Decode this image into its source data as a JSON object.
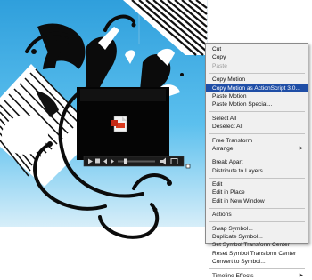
{
  "menu": {
    "items": [
      {
        "id": "cut",
        "label": "Cut",
        "disabled": false
      },
      {
        "id": "copy",
        "label": "Copy",
        "disabled": false
      },
      {
        "id": "paste",
        "label": "Paste",
        "disabled": true
      },
      {
        "sep": true
      },
      {
        "id": "copy-motion",
        "label": "Copy Motion",
        "disabled": false
      },
      {
        "id": "copy-motion-as3",
        "label": "Copy Motion as ActionScript 3.0...",
        "disabled": false,
        "selected": true
      },
      {
        "id": "paste-motion",
        "label": "Paste Motion",
        "disabled": false
      },
      {
        "id": "paste-motion-special",
        "label": "Paste Motion Special...",
        "disabled": false
      },
      {
        "sep": true
      },
      {
        "id": "select-all",
        "label": "Select All",
        "disabled": false
      },
      {
        "id": "deselect-all",
        "label": "Deselect All",
        "disabled": false
      },
      {
        "sep": true
      },
      {
        "id": "free-transform",
        "label": "Free Transform",
        "disabled": false
      },
      {
        "id": "arrange",
        "label": "Arrange",
        "disabled": false,
        "submenu": true
      },
      {
        "sep": true
      },
      {
        "id": "break-apart",
        "label": "Break Apart",
        "disabled": false
      },
      {
        "id": "distribute-to-layers",
        "label": "Distribute to Layers",
        "disabled": false
      },
      {
        "sep": true
      },
      {
        "id": "edit",
        "label": "Edit",
        "disabled": false
      },
      {
        "id": "edit-in-place",
        "label": "Edit in Place",
        "disabled": false
      },
      {
        "id": "edit-in-new-window",
        "label": "Edit in New Window",
        "disabled": false
      },
      {
        "sep": true
      },
      {
        "id": "actions",
        "label": "Actions",
        "disabled": false
      },
      {
        "sep": true
      },
      {
        "id": "swap-symbol",
        "label": "Swap Symbol...",
        "disabled": false
      },
      {
        "id": "duplicate-symbol",
        "label": "Duplicate Symbol...",
        "disabled": false
      },
      {
        "id": "set-symbol-transform-center",
        "label": "Set Symbol Transform Center",
        "disabled": false
      },
      {
        "id": "reset-symbol-transform-center",
        "label": "Reset Symbol Transform Center",
        "disabled": false
      },
      {
        "id": "convert-to-symbol",
        "label": "Convert to Symbol...",
        "disabled": false
      },
      {
        "sep": true
      },
      {
        "id": "timeline-effects",
        "label": "Timeline Effects",
        "disabled": false,
        "submenu": true
      }
    ],
    "submenu_arrow": "▶"
  },
  "stage": {
    "sky_color": "#3aaee3",
    "silhouette_color": "#0b0b0b",
    "stripe_color": "#111111",
    "video_icon": "video-file-icon",
    "player_controls": [
      "play-icon",
      "stop-icon",
      "back-icon",
      "forward-icon",
      "seek-bar",
      "volume-icon",
      "fullscreen-icon"
    ]
  }
}
